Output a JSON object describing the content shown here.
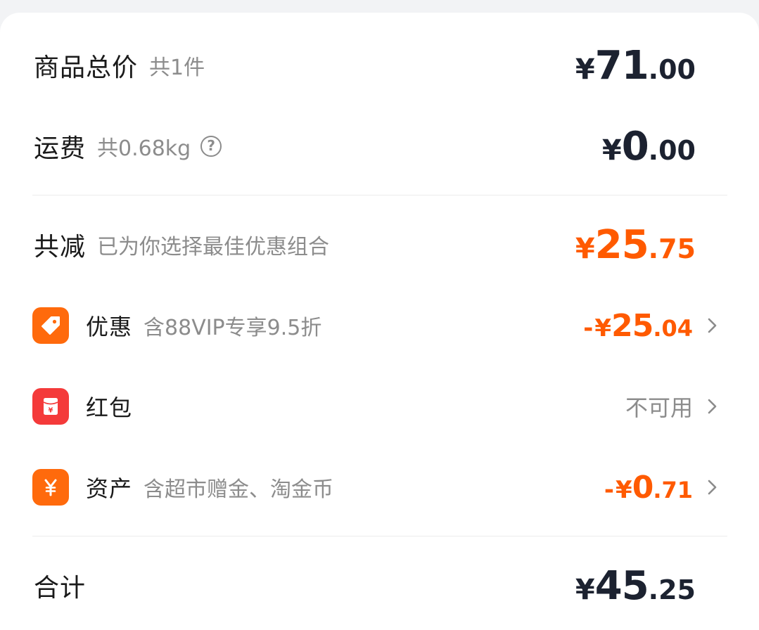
{
  "summary": {
    "goods_total": {
      "label": "商品总价",
      "hint": "共1件",
      "yen": "¥",
      "int": "71",
      "dec": ".00"
    },
    "shipping": {
      "label": "运费",
      "hint": "共0.68kg",
      "help_icon": "question-circle-icon",
      "help_glyph": "?",
      "yen": "¥",
      "int": "0",
      "dec": ".00"
    },
    "total_reduction": {
      "label": "共减",
      "hint": "已为你选择最佳优惠组合",
      "yen": "¥",
      "int": "25",
      "dec": ".75"
    },
    "discount": {
      "icon": "tag-icon",
      "label": "优惠",
      "hint": "含88VIP专享9.5折",
      "minus": "-",
      "yen": "¥",
      "int": "25",
      "dec": ".04"
    },
    "red_packet": {
      "icon": "red-packet-icon",
      "label": "红包",
      "status": "不可用"
    },
    "assets": {
      "icon": "yen-icon",
      "label": "资产",
      "hint": "含超市赠金、淘金币",
      "minus": "-",
      "yen": "¥",
      "int": "0",
      "dec": ".71"
    },
    "grand_total": {
      "label": "合计",
      "yen": "¥",
      "int": "45",
      "dec": ".25"
    }
  },
  "colors": {
    "accent_orange": "#ff5a00",
    "icon_orange": "#ff6a0c",
    "icon_red": "#f43a3a",
    "amount_dark": "#1c2230",
    "muted_text": "#8c8c8c"
  }
}
